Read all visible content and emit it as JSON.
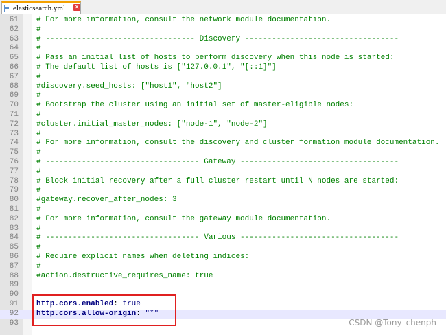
{
  "tab": {
    "filename": "elasticsearch.yml",
    "close_glyph": "✕",
    "icon": "yaml-file-icon"
  },
  "lines": [
    {
      "n": "61",
      "segs": [
        {
          "t": "# For more information, consult the network module documentation.",
          "c": "comment"
        }
      ]
    },
    {
      "n": "62",
      "segs": [
        {
          "t": "#",
          "c": "comment"
        }
      ]
    },
    {
      "n": "63",
      "segs": [
        {
          "t": "# --------------------------------- Discovery ----------------------------------",
          "c": "comment"
        }
      ]
    },
    {
      "n": "64",
      "segs": [
        {
          "t": "#",
          "c": "comment"
        }
      ]
    },
    {
      "n": "65",
      "segs": [
        {
          "t": "# Pass an initial list of hosts to perform discovery when this node is started:",
          "c": "comment"
        }
      ]
    },
    {
      "n": "66",
      "segs": [
        {
          "t": "# The default list of hosts is [\"127.0.0.1\", \"[::1]\"]",
          "c": "comment"
        }
      ]
    },
    {
      "n": "67",
      "segs": [
        {
          "t": "#",
          "c": "comment"
        }
      ]
    },
    {
      "n": "68",
      "segs": [
        {
          "t": "#discovery.seed_hosts: [\"host1\", \"host2\"]",
          "c": "comment"
        }
      ]
    },
    {
      "n": "69",
      "segs": [
        {
          "t": "#",
          "c": "comment"
        }
      ]
    },
    {
      "n": "70",
      "segs": [
        {
          "t": "# Bootstrap the cluster using an initial set of master-eligible nodes:",
          "c": "comment"
        }
      ]
    },
    {
      "n": "71",
      "segs": [
        {
          "t": "#",
          "c": "comment"
        }
      ]
    },
    {
      "n": "72",
      "segs": [
        {
          "t": "#cluster.initial_master_nodes: [\"node-1\", \"node-2\"]",
          "c": "comment"
        }
      ]
    },
    {
      "n": "73",
      "segs": [
        {
          "t": "#",
          "c": "comment"
        }
      ]
    },
    {
      "n": "74",
      "segs": [
        {
          "t": "# For more information, consult the discovery and cluster formation module documentation.",
          "c": "comment"
        }
      ]
    },
    {
      "n": "75",
      "segs": [
        {
          "t": "#",
          "c": "comment"
        }
      ]
    },
    {
      "n": "76",
      "segs": [
        {
          "t": "# ---------------------------------- Gateway -----------------------------------",
          "c": "comment"
        }
      ]
    },
    {
      "n": "77",
      "segs": [
        {
          "t": "#",
          "c": "comment"
        }
      ]
    },
    {
      "n": "78",
      "segs": [
        {
          "t": "# Block initial recovery after a full cluster restart until N nodes are started:",
          "c": "comment"
        }
      ]
    },
    {
      "n": "79",
      "segs": [
        {
          "t": "#",
          "c": "comment"
        }
      ]
    },
    {
      "n": "80",
      "segs": [
        {
          "t": "#gateway.recover_after_nodes: 3",
          "c": "comment"
        }
      ]
    },
    {
      "n": "81",
      "segs": [
        {
          "t": "#",
          "c": "comment"
        }
      ]
    },
    {
      "n": "82",
      "segs": [
        {
          "t": "# For more information, consult the gateway module documentation.",
          "c": "comment"
        }
      ]
    },
    {
      "n": "83",
      "segs": [
        {
          "t": "#",
          "c": "comment"
        }
      ]
    },
    {
      "n": "84",
      "segs": [
        {
          "t": "# ---------------------------------- Various -----------------------------------",
          "c": "comment"
        }
      ]
    },
    {
      "n": "85",
      "segs": [
        {
          "t": "#",
          "c": "comment"
        }
      ]
    },
    {
      "n": "86",
      "segs": [
        {
          "t": "# Require explicit names when deleting indices:",
          "c": "comment"
        }
      ]
    },
    {
      "n": "87",
      "segs": [
        {
          "t": "#",
          "c": "comment"
        }
      ]
    },
    {
      "n": "88",
      "segs": [
        {
          "t": "#action.destructive_requires_name: true",
          "c": "comment"
        }
      ]
    },
    {
      "n": "89",
      "segs": []
    },
    {
      "n": "90",
      "segs": []
    },
    {
      "n": "91",
      "segs": [
        {
          "t": "http.cors.enabled",
          "c": "key"
        },
        {
          "t": ": ",
          "c": "punct"
        },
        {
          "t": "true",
          "c": "val"
        }
      ]
    },
    {
      "n": "92",
      "current": true,
      "segs": [
        {
          "t": "http.cors.allow-origin",
          "c": "key"
        },
        {
          "t": ": ",
          "c": "punct"
        },
        {
          "t": "\"*\"",
          "c": "val"
        }
      ]
    },
    {
      "n": "93",
      "segs": []
    }
  ],
  "watermark": "CSDN @Tony_chenph",
  "colors": {
    "comment": "#008000",
    "key": "#000080",
    "line_number": "#808080",
    "current_line": "#e8e8ff",
    "highlight_box": "#e02020"
  }
}
